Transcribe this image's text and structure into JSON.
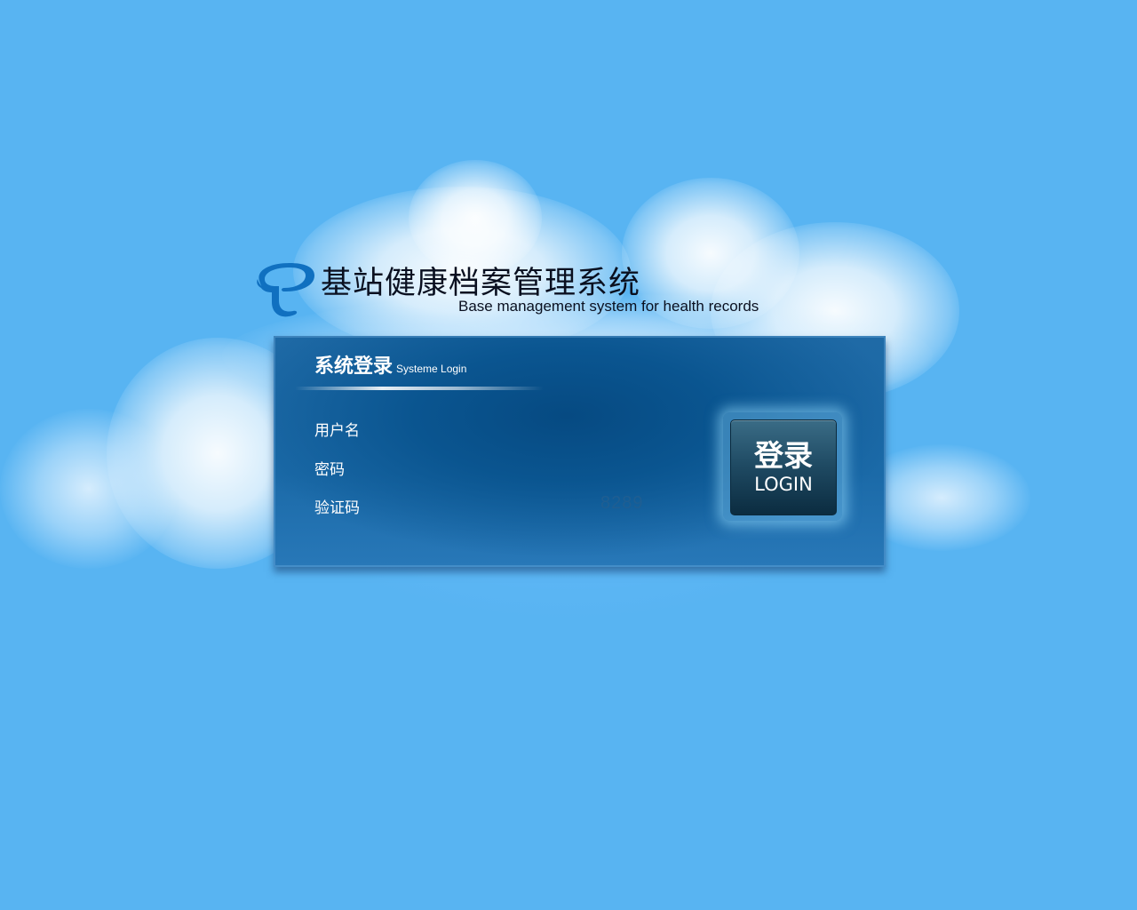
{
  "header": {
    "title_cn": "基站健康档案管理系统",
    "title_en": "Base management system for health records",
    "logo_icon": "china-telecom-logo-icon"
  },
  "login_panel": {
    "title_cn": "系统登录",
    "title_en": "Systeme Login",
    "fields": {
      "username_label": "用户名",
      "username_value": "",
      "password_label": "密码",
      "password_value": "",
      "captcha_label": "验证码",
      "captcha_value": "",
      "captcha_code": "8289"
    },
    "login_button": {
      "label_cn": "登录",
      "label_en": "LOGIN"
    }
  },
  "colors": {
    "background": "#58b4f2",
    "panel": "#0a5590",
    "logo_blue": "#1070c0",
    "button_dark": "#0b2c40"
  }
}
